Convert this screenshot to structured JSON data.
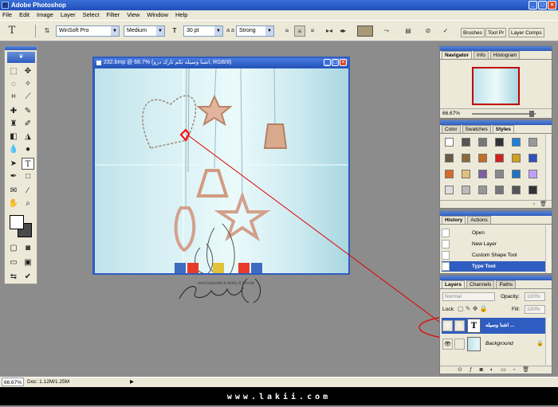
{
  "app": {
    "title": "Adobe Photoshop"
  },
  "menu": [
    "File",
    "Edit",
    "Image",
    "Layer",
    "Select",
    "Filter",
    "View",
    "Window",
    "Help"
  ],
  "options": {
    "font_family": "WinSoft Pro",
    "font_style": "Medium",
    "font_size": "30 pt",
    "aa_label": "a a",
    "antialias": "Strong",
    "text_color": "#a89a76",
    "dock_tabs": [
      "Brushes",
      "Tool Pr",
      "Layer Comps"
    ]
  },
  "document": {
    "title": "232.bmp @ 66.7% (ﺍﺷﻨﺎ ﻭﺳﻴﻠﻪ ﺗﻜﻢ ﺗﺎﺭﻙ ﺩﺭﻭ, RGB/8)",
    "watermark_sub": "www.lakiishild & family & friends"
  },
  "navigator": {
    "tabs": [
      "Navigator",
      "Info",
      "Histogram"
    ],
    "zoom": "66.67%"
  },
  "color_panel": {
    "tabs": [
      "Color",
      "Swatches",
      "Styles"
    ]
  },
  "history": {
    "tabs": [
      "History",
      "Actions"
    ],
    "items": [
      "Open",
      "New Layer",
      "Custom Shape Tool",
      "Type Tool"
    ]
  },
  "layers": {
    "tabs": [
      "Layers",
      "Channels",
      "Paths"
    ],
    "blend_mode": "Normal",
    "opacity_label": "Opacity:",
    "opacity": "100%",
    "lock_label": "Lock:",
    "fill_label": "Fill:",
    "fill": "100%",
    "items": [
      {
        "name": "ﺍﺷﻨﺎ ﻭﺳﻴﻠﻪ ...",
        "thumb": "T",
        "selected": true
      },
      {
        "name": "Background",
        "thumb": "",
        "selected": false
      }
    ]
  },
  "status": {
    "zoom": "66.67%",
    "doc": "Doc: 1.12M/1.25M"
  },
  "footer": "www.lakii.com",
  "colors": {
    "accent": "#2f5cc0",
    "annotation": "#e00000",
    "chrome": "#ece9d8"
  }
}
